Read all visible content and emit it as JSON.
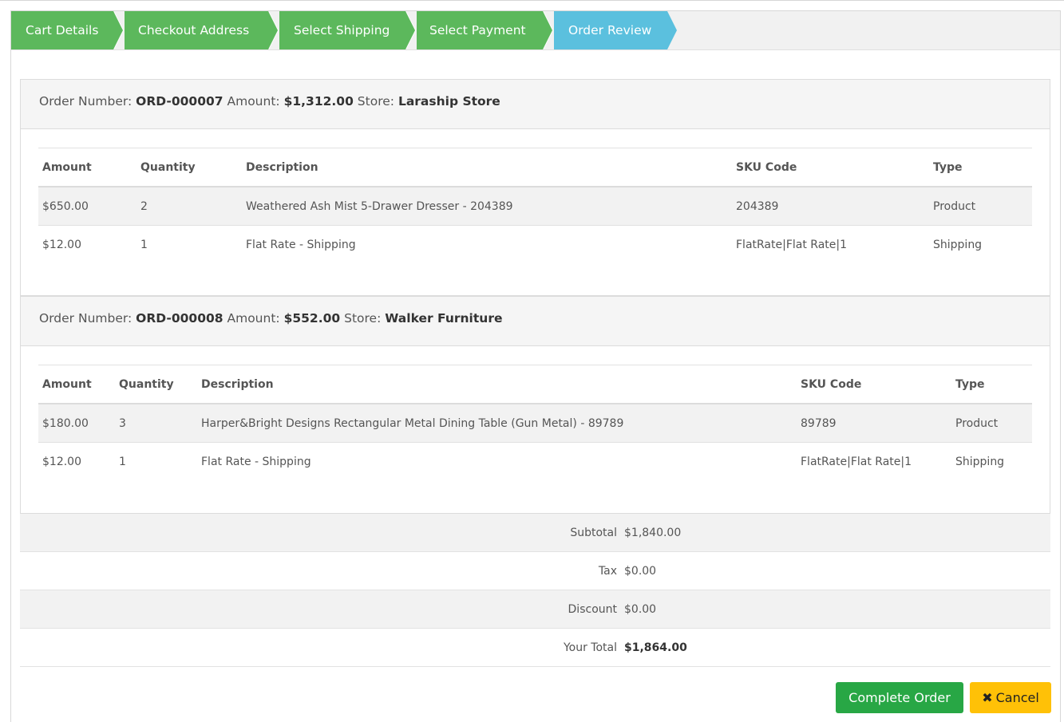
{
  "steps": [
    {
      "label": "Cart Details",
      "state": "done"
    },
    {
      "label": "Checkout Address",
      "state": "done"
    },
    {
      "label": "Select Shipping",
      "state": "done"
    },
    {
      "label": "Select Payment",
      "state": "done"
    },
    {
      "label": "Order Review",
      "state": "active"
    }
  ],
  "orders": [
    {
      "number_label": "Order Number:",
      "number": "ORD-000007",
      "amount_label": "Amount:",
      "amount": "$1,312.00",
      "store_label": "Store:",
      "store": "Laraship Store",
      "columns": [
        "Amount",
        "Quantity",
        "Description",
        "SKU Code",
        "Type"
      ],
      "rows": [
        {
          "amount": "$650.00",
          "quantity": "2",
          "description": "Weathered Ash Mist 5-Drawer Dresser - 204389",
          "sku": "204389",
          "type": "Product"
        },
        {
          "amount": "$12.00",
          "quantity": "1",
          "description": "Flat Rate - Shipping",
          "sku": "FlatRate|Flat Rate|1",
          "type": "Shipping"
        }
      ]
    },
    {
      "number_label": "Order Number:",
      "number": "ORD-000008",
      "amount_label": "Amount:",
      "amount": "$552.00",
      "store_label": "Store:",
      "store": "Walker Furniture",
      "columns": [
        "Amount",
        "Quantity",
        "Description",
        "SKU Code",
        "Type"
      ],
      "rows": [
        {
          "amount": "$180.00",
          "quantity": "3",
          "description": "Harper&Bright Designs Rectangular Metal Dining Table (Gun Metal) - 89789",
          "sku": "89789",
          "type": "Product"
        },
        {
          "amount": "$12.00",
          "quantity": "1",
          "description": "Flat Rate - Shipping",
          "sku": "FlatRate|Flat Rate|1",
          "type": "Shipping"
        }
      ]
    }
  ],
  "totals": {
    "subtotal_label": "Subtotal",
    "subtotal": "$1,840.00",
    "tax_label": "Tax",
    "tax": "$0.00",
    "discount_label": "Discount",
    "discount": "$0.00",
    "total_label": "Your Total",
    "total": "$1,864.00"
  },
  "buttons": {
    "complete": "Complete Order",
    "cancel_icon": "✖",
    "cancel": "Cancel"
  },
  "colors": {
    "step_done": "#5cb85c",
    "step_active": "#5bc0de",
    "complete_button": "#28a745",
    "cancel_button": "#ffc107"
  }
}
